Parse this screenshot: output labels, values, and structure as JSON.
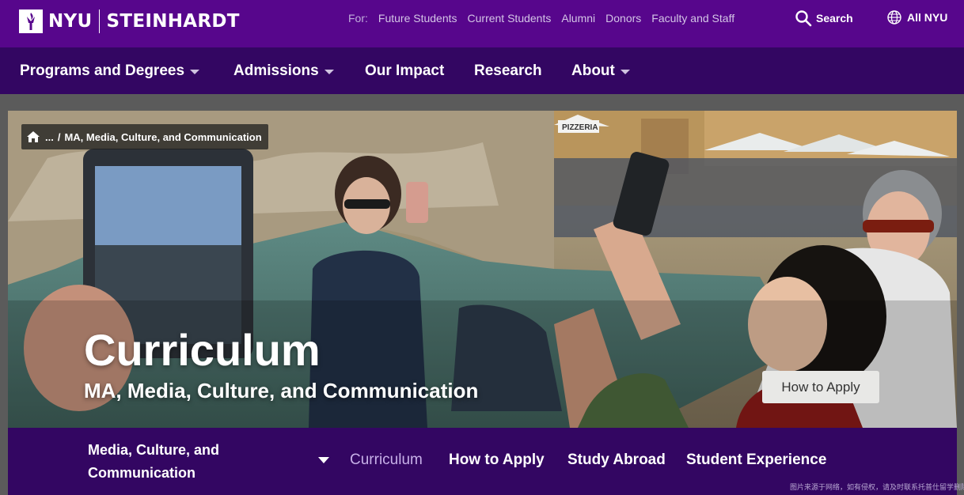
{
  "header": {
    "logo_text_left": "NYU",
    "logo_text_right": "STEINHARDT",
    "audience_label": "For:",
    "audience_links": [
      "Future Students",
      "Current Students",
      "Alumni",
      "Donors",
      "Faculty and Staff"
    ],
    "search_label": "Search",
    "all_nyu_label": "All NYU"
  },
  "main_nav": {
    "items": [
      {
        "label": "Programs and Degrees",
        "has_dropdown": true
      },
      {
        "label": "Admissions",
        "has_dropdown": true
      },
      {
        "label": "Our Impact",
        "has_dropdown": false
      },
      {
        "label": "Research",
        "has_dropdown": false
      },
      {
        "label": "About",
        "has_dropdown": true
      }
    ]
  },
  "hero": {
    "breadcrumb_ellipsis": "...",
    "breadcrumb_separator": "/",
    "breadcrumb_current": "MA, Media, Culture, and Communication",
    "title": "Curriculum",
    "subtitle": "MA, Media, Culture, and Communication",
    "apply_button": "How to Apply",
    "sign_text": "PIZZERIA"
  },
  "sub_nav": {
    "program_name": "Media, Culture, and Communication",
    "items": [
      {
        "label": "Curriculum",
        "active": true
      },
      {
        "label": "How to Apply",
        "active": false
      },
      {
        "label": "Study Abroad",
        "active": false
      },
      {
        "label": "Student Experience",
        "active": false
      }
    ]
  },
  "watermark": "图片来源于网络，如有侵权，请及时联系托普仕留学删除",
  "colors": {
    "brand_purple": "#57068c",
    "dark_purple": "#330662",
    "active_subnav": "#c7b0e8"
  },
  "icons": [
    "nyu-torch-icon",
    "search-icon",
    "globe-icon",
    "home-icon",
    "chevron-down-icon"
  ]
}
